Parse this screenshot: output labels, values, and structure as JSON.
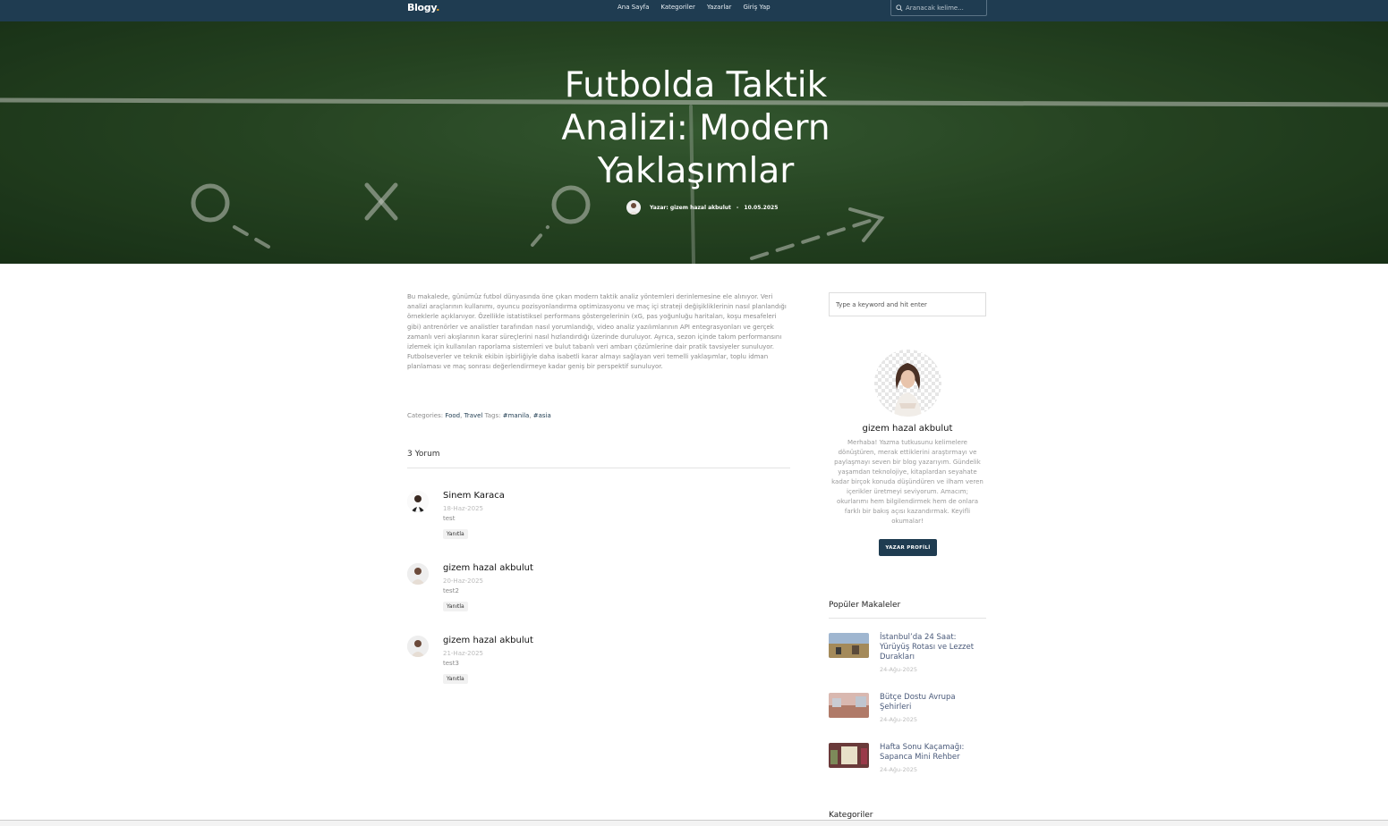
{
  "nav": {
    "brand": "Blogy",
    "brand_dot": ".",
    "links": [
      "Ana Sayfa",
      "Kategoriler",
      "Yazarlar",
      "Giriş Yap"
    ],
    "search_placeholder": "Aranacak kelime..."
  },
  "hero": {
    "title": "Futbolda Taktik Analizi: Modern Yaklaşımlar",
    "author": "Yazar: gizem hazal akbulut",
    "separator": "-",
    "date": "10.05.2025"
  },
  "article": {
    "body": "Bu makalede, günümüz futbol dünyasında öne çıkan modern taktik analiz yöntemleri derinlemesine ele alınıyor. Veri analizi araçlarının kullanımı, oyuncu pozisyonlandırma optimizasyonu ve maç içi strateji değişikliklerinin nasıl planlandığı örneklerle açıklanıyor. Özellikle istatistiksel performans göstergelerinin (xG, pas yoğunluğu haritaları, koşu mesafeleri gibi) antrenörler ve analistler tarafından nasıl yorumlandığı, video analiz yazılımlarının API entegrasyonları ve gerçek zamanlı veri akışlarının karar süreçlerini nasıl hızlandırdığı üzerinde duruluyor. Ayrıca, sezon içinde takım performansını izlemek için kullanılan raporlama sistemleri ve bulut tabanlı veri ambarı çözümlerine dair pratik tavsiyeler sunuluyor. Futbolseverler ve teknik ekibin işbirliğiyle daha isabetli karar almayı sağlayan veri temelli yaklaşımlar, toplu idman planlaması ve maç sonrası değerlendirmeye kadar geniş bir perspektif sunuluyor.",
    "categories_label": "Categories:",
    "categories": [
      "Food",
      "Travel"
    ],
    "tags_label": "Tags:",
    "tags": [
      "#manila",
      "#asia"
    ]
  },
  "comments": {
    "title": "3 Yorum",
    "reply_label": "Yanıtla",
    "items": [
      {
        "name": "Sinem Karaca",
        "date": "18-Haz-2025",
        "text": "test"
      },
      {
        "name": "gizem hazal akbulut",
        "date": "20-Haz-2025",
        "text": "test2"
      },
      {
        "name": "gizem hazal akbulut",
        "date": "21-Haz-2025",
        "text": "test3"
      }
    ]
  },
  "sidebar": {
    "search_placeholder": "Type a keyword and hit enter",
    "author": {
      "name": "gizem hazal akbulut",
      "bio": "Merhaba! Yazma tutkusunu kelimelere dönüştüren, merak ettiklerini araştırmayı ve paylaşmayı seven bir blog yazarıyım. Gündelik yaşamdan teknolojiye, kitaplardan seyahate kadar birçok konuda düşündüren ve ilham veren içerikler üretmeyi seviyorum. Amacım; okurlarımı hem bilgilendirmek hem de onlara farklı bir bakış açısı kazandırmak. Keyifli okumalar!",
      "button": "YAZAR PROFİLİ"
    },
    "popular_title": "Popüler Makaleler",
    "popular": [
      {
        "title": "İstanbul’da 24 Saat: Yürüyüş Rotası ve Lezzet Durakları",
        "date": "24-Ağu-2025"
      },
      {
        "title": "Bütçe Dostu Avrupa Şehirleri",
        "date": "24-Ağu-2025"
      },
      {
        "title": "Hafta Sonu Kaçamağı: Sapanca Mini Rehber",
        "date": "24-Ağu-2025"
      }
    ],
    "categories_title": "Kategoriler"
  },
  "colors": {
    "nav_bg": "#1f3c51",
    "button_bg": "#1f3c51",
    "link": "#1f3c51"
  }
}
